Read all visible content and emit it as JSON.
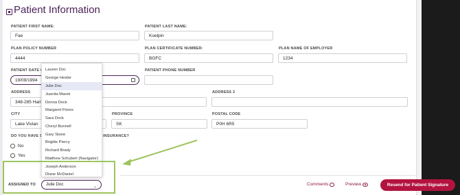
{
  "page": {
    "title": "Patient Information"
  },
  "fields": {
    "first_name": {
      "label": "PATIENT FIRST NAME:",
      "value": "Fae"
    },
    "last_name": {
      "label": "PATIENT LAST NAME:",
      "value": "Koelpin"
    },
    "policy_number": {
      "label": "PLAN POLICY NUMBER",
      "value": "4444"
    },
    "certificate_number": {
      "label": "PLAN CERTIFICATE NUMBER:",
      "value": "BGFC"
    },
    "employer": {
      "label": "PLAN NAME OF EMPLOYER",
      "value": "1234"
    },
    "dob": {
      "label": "PATIENT DATE O",
      "value": "19/09/1994"
    },
    "phone": {
      "label": "PATIENT PHONE NUMBER",
      "value": ""
    },
    "address": {
      "label": "ADDRESS",
      "value": "348-285 Harl"
    },
    "address2": {
      "label": "ADDRESS 2",
      "value": ""
    },
    "city": {
      "label": "CITY",
      "value": "Lake Vivian"
    },
    "province": {
      "label": "PROVINCE",
      "value": "SK"
    },
    "postal_code": {
      "label": "POSTAL CODE",
      "value": "P0H 6R5"
    }
  },
  "question": {
    "label_left": "DO YOU HAVE S",
    "label_right": "INSURANCE?",
    "options": [
      "No",
      "Yes"
    ]
  },
  "dropdown": {
    "items": [
      "Lauren Doc",
      "George Hester",
      "Julie Doc",
      "Juanita Marek",
      "Donna Dock",
      "Margaret Flores",
      "Sara Dock",
      "Cheryl Bunnell",
      "Gary Stone",
      "Brigitte Piercy",
      "Richard Brady",
      "Matthew Schubert (Navigator)",
      "Joseph Anderson",
      "Diane McDaniel"
    ],
    "selected_index": 2
  },
  "footer": {
    "assigned_label": "ASSIGNED TO",
    "assigned_value": "Julie Doc",
    "comments": "Comments",
    "preview": "Preview",
    "resend": "Resend for Patient Signature"
  },
  "colors": {
    "brand": "#4b2257",
    "accent": "#b3133f",
    "highlight": "#9cc45c",
    "dropdown_selected": "#e6e8f6"
  }
}
